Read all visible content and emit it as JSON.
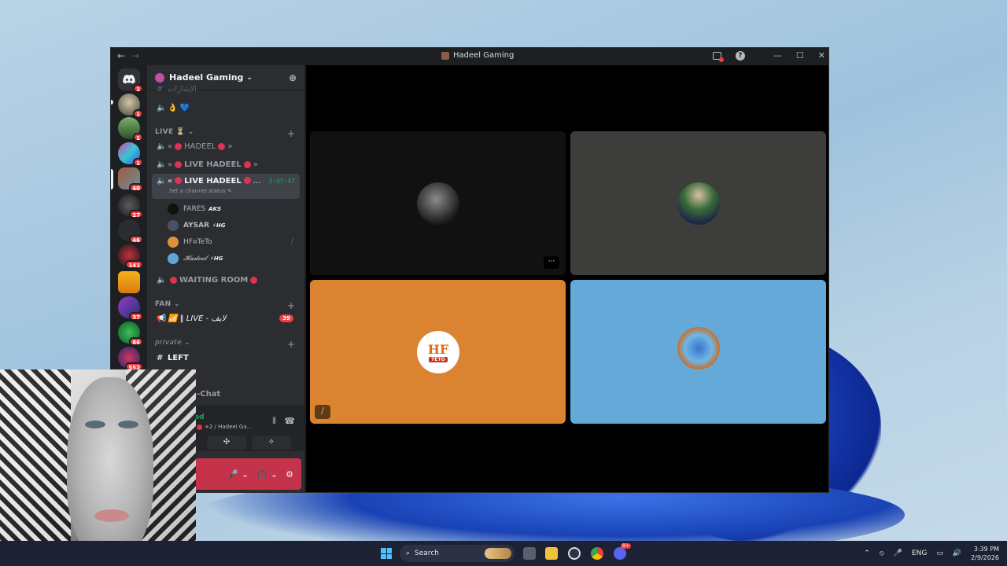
{
  "window": {
    "title": "Hadeel Gaming",
    "nav_back": "←",
    "nav_fwd": "→",
    "help": "?",
    "minimize": "—",
    "maximize": "☐",
    "close": "✕"
  },
  "server_rail": {
    "badges": [
      "1",
      "1",
      "1",
      "1",
      "40",
      "27",
      "46",
      "141",
      "37",
      "86",
      "552"
    ]
  },
  "server": {
    "name": "Hadeel Gaming",
    "chevron": "⌄",
    "invite_icon": "person-add-icon"
  },
  "channels": {
    "top_hidden": "الإشارات",
    "first_voice": "👌 💙",
    "cat_live": "LIVE ⏳",
    "ch1": {
      "pre": "«",
      "name": "HADEEL",
      "post": "»"
    },
    "ch2": {
      "pre": "«",
      "name": "LIVE HADEEL",
      "post": "»"
    },
    "ch3": {
      "pre": "«",
      "name": "LIVE HADEEL",
      "post": "...",
      "timer": "3:47:47",
      "status": "Set a channel status ✎"
    },
    "members": [
      {
        "name": "FARES",
        "tag": "AKS"
      },
      {
        "name": "AYSAR",
        "tag": "⚡HG"
      },
      {
        "name": "HF¤TeTo",
        "tag": ""
      },
      {
        "name": "𝓗𝓪𝓭𝓮𝓮𝓵",
        "tag": "⚡HG"
      }
    ],
    "waiting": "WAITING ROOM",
    "cat_fan": "FAN",
    "fan_ch": "📶 ‖ LIVE - لايف",
    "fan_badge": "39",
    "cat_private": "private",
    "left": "LEFT",
    "chat": "S-Chat"
  },
  "voice_panel": {
    "line1": "ed",
    "line2": "+2 / Hadeel Ga...",
    "wave": "⦀",
    "hang": "☎"
  },
  "userbar": {
    "mic": "🎤",
    "mic_chev": "⌄",
    "headset": "🎧",
    "head_chev": "⌄",
    "settings": "⚙"
  },
  "stage": {
    "more": "···",
    "teto_label": "TETO",
    "teto_letters": "HF"
  },
  "taskbar": {
    "search": "Search",
    "lang": "ENG",
    "time": "3:39 PM",
    "date": "2/9/2026",
    "discord_badge": "9+"
  },
  "colors": {
    "accent": "#5865f2",
    "live_green": "#23a559",
    "red": "#f23f43",
    "tile_orange": "#da8330",
    "tile_blue": "#64a9d7",
    "tile_gray": "#3d3d3b"
  }
}
